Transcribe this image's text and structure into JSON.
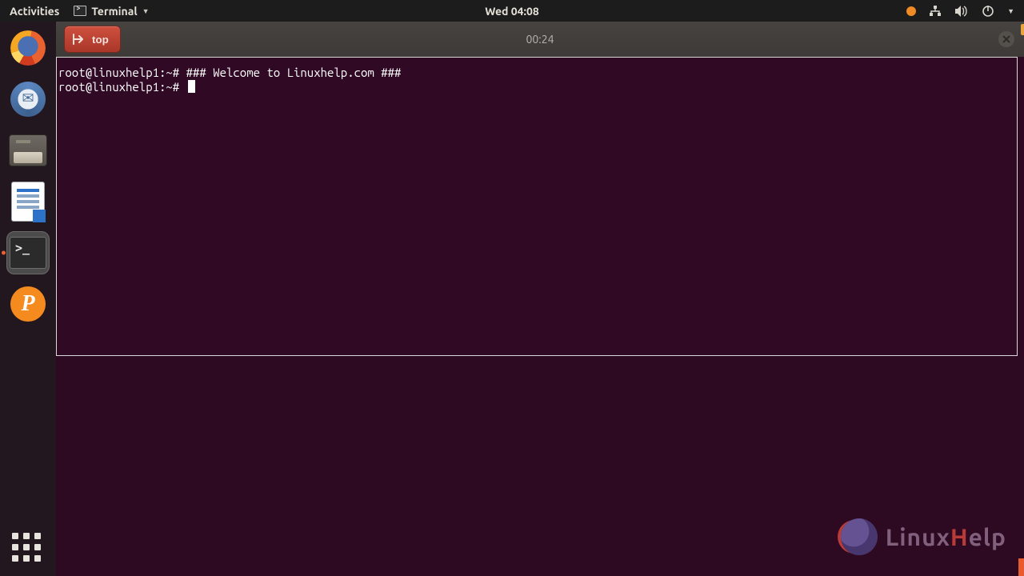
{
  "topbar": {
    "activities": "Activities",
    "app_name": "Terminal",
    "clock": "Wed 04:08"
  },
  "recorder": {
    "stop_label": "top",
    "timer": "00:24"
  },
  "terminal": {
    "menu_fragment": "",
    "line1_prompt": "root@linuxhelp1:~#",
    "line1_text": " ### Welcome to Linuxhelp.com ###",
    "line2_prompt": "root@linuxhelp1:~#"
  },
  "watermark": {
    "text_plain": "Linux",
    "text_accent": "H",
    "text_tail": "elp"
  },
  "dock": {
    "items": [
      "firefox",
      "thunderbird",
      "files",
      "writer",
      "terminal",
      "psiphon"
    ]
  }
}
